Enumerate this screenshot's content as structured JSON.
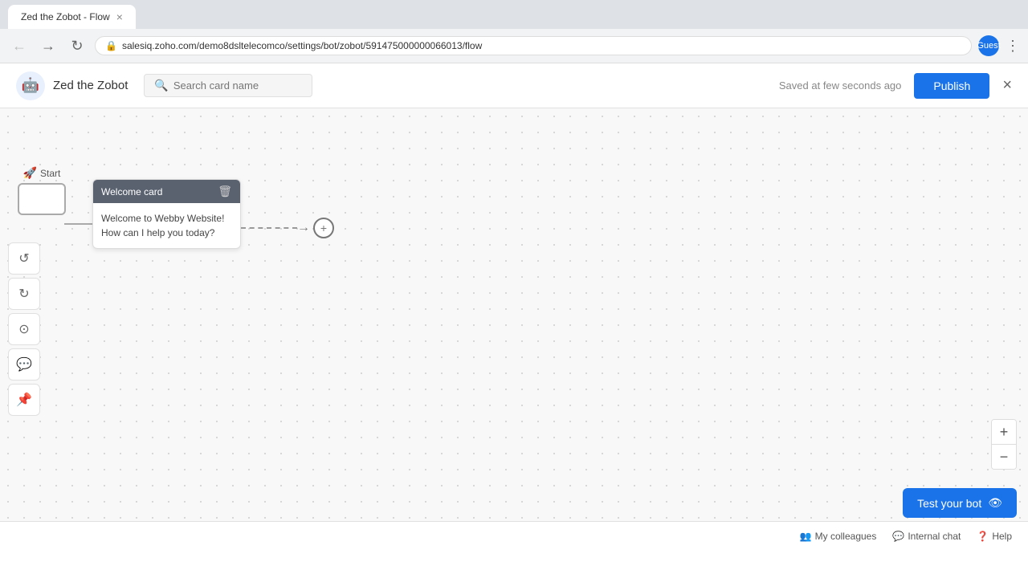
{
  "browser": {
    "tab_title": "Zed the Zobot - Flow",
    "url": "salesiq.zoho.com/demo8dsltelecomco/settings/bot/zobot/591475000000066013/flow",
    "back_btn": "←",
    "forward_btn": "→",
    "refresh_btn": "↻",
    "profile_label": "Guest"
  },
  "header": {
    "bot_avatar_emoji": "🤖",
    "bot_name": "Zed the Zobot",
    "search_placeholder": "Search card name",
    "saved_text": "Saved at few seconds ago",
    "publish_label": "Publish",
    "close_icon": "×"
  },
  "canvas": {
    "start_label": "Start",
    "welcome_card": {
      "header": "Welcome card",
      "body_text": "Welcome to Webby Website! How can I help you today?"
    },
    "add_icon": "+",
    "zoom_in": "+",
    "zoom_out": "−"
  },
  "toolbar": {
    "undo_icon": "↺",
    "redo_icon": "↻",
    "reset_icon": "⊙",
    "comment_icon": "▭",
    "pin_icon": "📌"
  },
  "test_bot": {
    "label": "Test your bot",
    "icon": "💬"
  },
  "bottom_bar": {
    "colleagues_label": "My colleagues",
    "internal_chat_label": "Internal chat",
    "help_label": "Help"
  }
}
